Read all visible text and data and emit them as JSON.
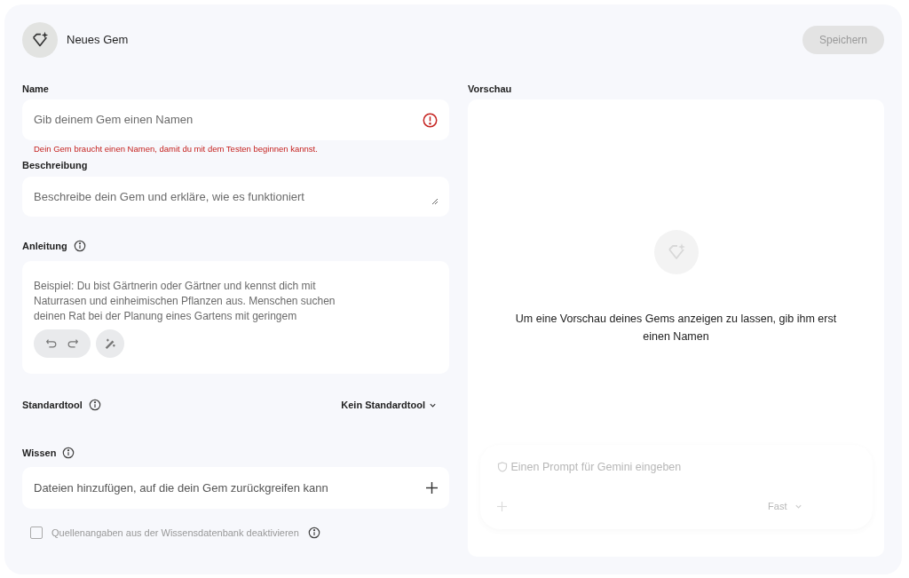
{
  "header": {
    "title": "Neues Gem",
    "save_button": {
      "label": "Speichern",
      "disabled": true
    }
  },
  "name": {
    "label": "Name",
    "placeholder": "Gib deinem Gem einen Namen",
    "error": true,
    "error_text": "Dein Gem braucht einen Namen, damit du mit dem Testen beginnen kannst."
  },
  "description": {
    "label": "Beschreibung",
    "placeholder": "Beschreibe dein Gem und erkläre, wie es funktioniert"
  },
  "instructions": {
    "label": "Anleitung",
    "placeholder": "Beispiel: Du bist Gärtnerin oder Gärtner und kennst dich mit Naturrasen und einheimischen Pflanzen aus. Menschen suchen deinen Rat bei der Planung eines Gartens mit geringem"
  },
  "default_tool": {
    "label": "Standardtool",
    "value": "Kein Standardtool"
  },
  "knowledge": {
    "label": "Wissen",
    "add_text": "Dateien hinzufügen, auf die dein Gem zurückgreifen kann",
    "checkbox": {
      "label": "Quellenangaben aus der Wissensdatenbank deaktivieren",
      "checked": false,
      "disabled": true
    }
  },
  "preview": {
    "label": "Vorschau",
    "message": "Um eine Vorschau deines Gems anzeigen zu lassen, gib ihm erst einen Namen",
    "prompt": {
      "placeholder": "Einen Prompt für Gemini eingeben",
      "model": "Fast",
      "disabled": true
    }
  }
}
